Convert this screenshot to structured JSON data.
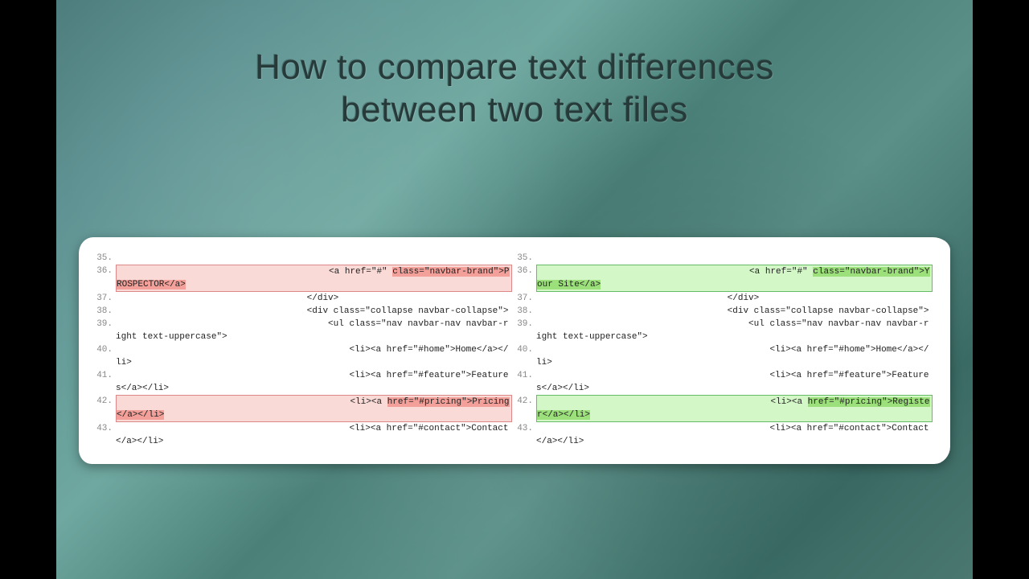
{
  "title_line1": "How to compare text differences",
  "title_line2": "between two text files",
  "left": {
    "rows": [
      {
        "n": "35.",
        "diff": false,
        "pre": "",
        "mark": "",
        "post": ""
      },
      {
        "n": "36.",
        "diff": true,
        "pre": "                                        <a href=\"#\" ",
        "mark": "class=\"navbar-brand\">PROSPECTOR</a>",
        "post": ""
      },
      {
        "n": "37.",
        "diff": false,
        "pre": "                                    </div>",
        "mark": "",
        "post": ""
      },
      {
        "n": "38.",
        "diff": false,
        "pre": "                                    <div class=\"collapse navbar-collapse\">",
        "mark": "",
        "post": ""
      },
      {
        "n": "39.",
        "diff": false,
        "pre": "                                        <ul class=\"nav navbar-nav navbar-right text-uppercase\">",
        "mark": "",
        "post": ""
      },
      {
        "n": "40.",
        "diff": false,
        "pre": "                                            <li><a href=\"#home\">Home</a></li>",
        "mark": "",
        "post": ""
      },
      {
        "n": "41.",
        "diff": false,
        "pre": "                                            <li><a href=\"#feature\">Features</a></li>",
        "mark": "",
        "post": ""
      },
      {
        "n": "42.",
        "diff": true,
        "pre": "                                            <li><a ",
        "mark": "href=\"#pricing\">Pricing</a></li>",
        "post": ""
      },
      {
        "n": "43.",
        "diff": false,
        "pre": "                                            <li><a href=\"#contact\">Contact</a></li>",
        "mark": "",
        "post": ""
      }
    ]
  },
  "right": {
    "rows": [
      {
        "n": "35.",
        "diff": false,
        "pre": "",
        "mark": "",
        "post": ""
      },
      {
        "n": "36.",
        "diff": true,
        "pre": "                                        <a href=\"#\" ",
        "mark": "class=\"navbar-brand\">Your Site</a>",
        "post": ""
      },
      {
        "n": "37.",
        "diff": false,
        "pre": "                                    </div>",
        "mark": "",
        "post": ""
      },
      {
        "n": "38.",
        "diff": false,
        "pre": "                                    <div class=\"collapse navbar-collapse\">",
        "mark": "",
        "post": ""
      },
      {
        "n": "39.",
        "diff": false,
        "pre": "                                        <ul class=\"nav navbar-nav navbar-right text-uppercase\">",
        "mark": "",
        "post": ""
      },
      {
        "n": "40.",
        "diff": false,
        "pre": "                                            <li><a href=\"#home\">Home</a></li>",
        "mark": "",
        "post": ""
      },
      {
        "n": "41.",
        "diff": false,
        "pre": "                                            <li><a href=\"#feature\">Features</a></li>",
        "mark": "",
        "post": ""
      },
      {
        "n": "42.",
        "diff": true,
        "pre": "                                            <li><a ",
        "mark": "href=\"#pricing\">Register</a></li>",
        "post": ""
      },
      {
        "n": "43.",
        "diff": false,
        "pre": "                                            <li><a href=\"#contact\">Contact</a></li>",
        "mark": "",
        "post": ""
      }
    ]
  }
}
